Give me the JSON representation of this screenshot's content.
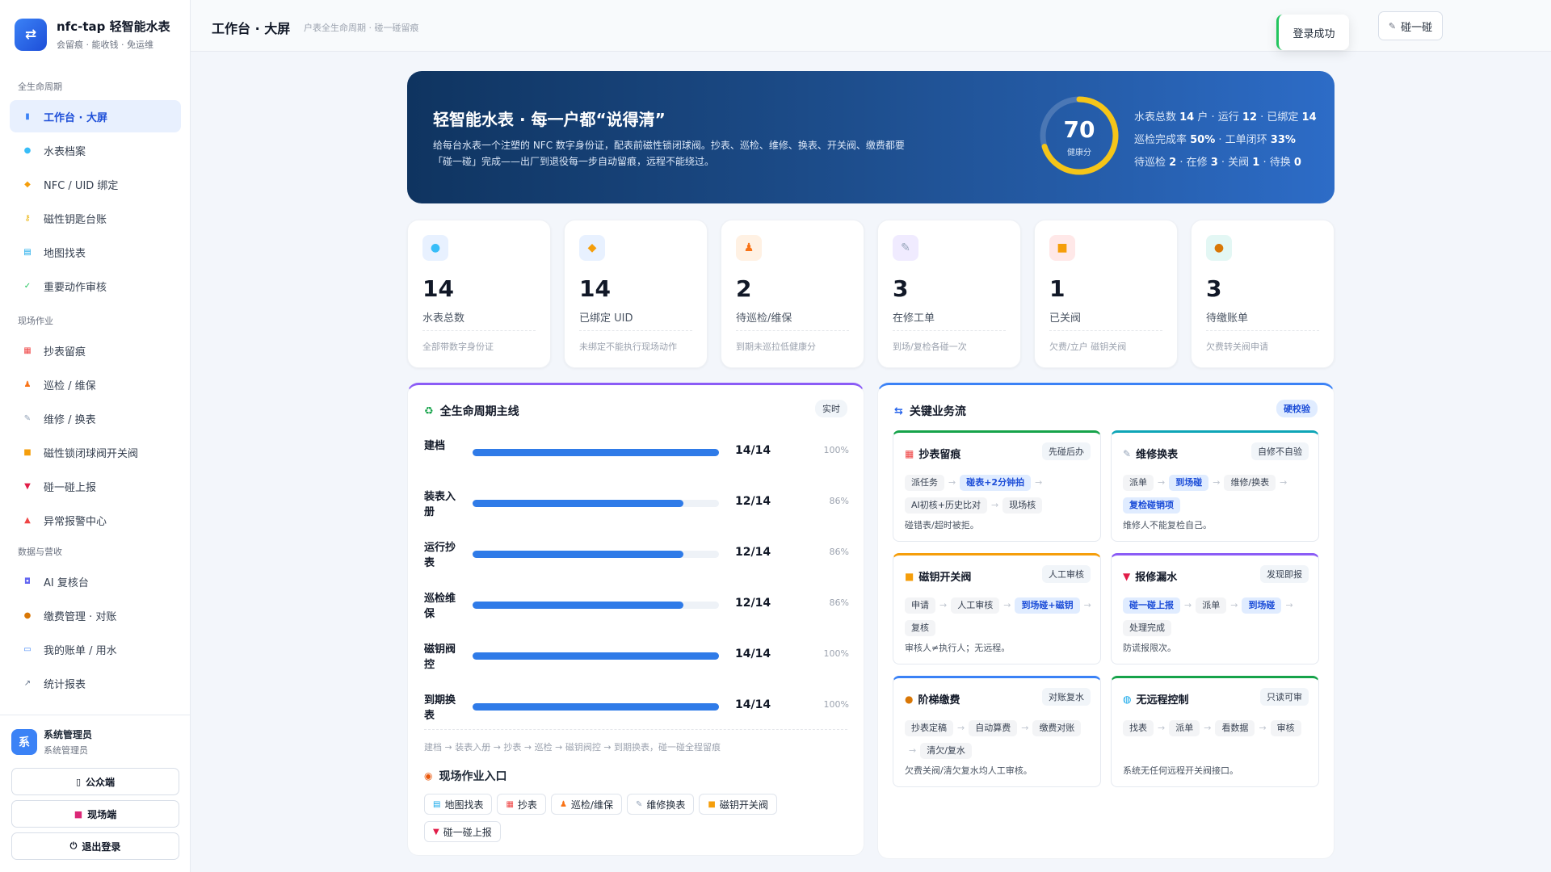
{
  "brand": {
    "title": "nfc-tap 轻智能水表",
    "subtitle": "会留痕 · 能收钱 · 免运维",
    "logo": "shuffle-icon"
  },
  "nav": {
    "groups": [
      {
        "title": "全生命周期",
        "items": [
          {
            "label": "工作台 · 大屏",
            "icon": "chart-icon",
            "active": true
          },
          {
            "label": "水表档案",
            "icon": "drop-icon"
          },
          {
            "label": "NFC / UID 绑定",
            "icon": "tag-icon"
          },
          {
            "label": "磁性钥匙台账",
            "icon": "key-icon"
          },
          {
            "label": "地图找表",
            "icon": "map-icon"
          },
          {
            "label": "重要动作审核",
            "icon": "check-icon"
          }
        ]
      },
      {
        "title": "现场作业",
        "items": [
          {
            "label": "抄表留痕",
            "icon": "abacus-icon"
          },
          {
            "label": "巡检 / 维保",
            "icon": "walker-icon"
          },
          {
            "label": "维修 / 换表",
            "icon": "wrench-icon"
          },
          {
            "label": "磁性锁闭球阀开关阀",
            "icon": "lock-icon"
          },
          {
            "label": "碰一碰上报",
            "icon": "bookmark-icon"
          },
          {
            "label": "异常报警中心",
            "icon": "alarm-icon"
          }
        ]
      },
      {
        "title": "数据与营收",
        "items": [
          {
            "label": "AI 复核台",
            "icon": "robot-icon"
          },
          {
            "label": "缴费管理 · 对账",
            "icon": "moneybag-icon"
          },
          {
            "label": "我的账单 / 用水",
            "icon": "card-icon"
          },
          {
            "label": "统计报表",
            "icon": "trend-icon"
          }
        ]
      }
    ]
  },
  "user": {
    "avatar": "系",
    "name": "系统管理员",
    "role": "系统管理员"
  },
  "footer_buttons": {
    "public": "公众端",
    "field": "现场端",
    "logout": "退出登录"
  },
  "header": {
    "title": "工作台 · 大屏",
    "subtitle": "户表全生命周期 · 碰一碰留痕",
    "tap_button": "碰一碰",
    "toast": "登录成功"
  },
  "hero": {
    "title": "轻智能水表 · 每一户都“说得清”",
    "desc": "给每台水表一个注塑的 NFC 数字身份证，配表前磁性锁闭球阀。抄表、巡检、维修、换表、开关阀、缴费都要「碰一碰」完成——出厂到退役每一步自动留痕，远程不能绕过。",
    "health_score": 70,
    "health_label": "健康分",
    "stats": [
      {
        "p1": "水表总数 ",
        "v1": "14",
        "p2": " 户 · 运行 ",
        "v2": "12",
        "p3": " · 已绑定 ",
        "v3": "14"
      },
      {
        "p1": "巡检完成率 ",
        "v1": "50%",
        "p2": " · 工单闭环 ",
        "v2": "33%",
        "p3": "",
        "v3": ""
      },
      {
        "p1": "待巡检 ",
        "v1": "2",
        "p2": " · 在修 ",
        "v2": "3",
        "p3": " · 关阀 ",
        "v3": "1",
        "p4": " · 待换 ",
        "v4": "0"
      }
    ]
  },
  "kpis": [
    {
      "num": "14",
      "label": "水表总数",
      "note": "全部带数字身份证",
      "icon": "drop-icon",
      "bg": "#e8f1ff"
    },
    {
      "num": "14",
      "label": "已绑定 UID",
      "note": "未绑定不能执行现场动作",
      "icon": "tag-icon",
      "bg": "#e8f1ff"
    },
    {
      "num": "2",
      "label": "待巡检/维保",
      "note": "到期未巡拉低健康分",
      "icon": "walker-icon",
      "bg": "#fff1e3"
    },
    {
      "num": "3",
      "label": "在修工单",
      "note": "到场/复检各碰一次",
      "icon": "wrench-icon",
      "bg": "#f0ebff"
    },
    {
      "num": "1",
      "label": "已关阀",
      "note": "欠费/立户 磁钥关阀",
      "icon": "lock-icon",
      "bg": "#ffe8e8"
    },
    {
      "num": "3",
      "label": "待缴账单",
      "note": "欠费转关阀申请",
      "icon": "moneybag-icon",
      "bg": "#e3f7f4"
    }
  ],
  "lifecycle": {
    "title": "全生命周期主线",
    "tag": "实时",
    "rows": [
      {
        "name": "建档",
        "count": "14/14",
        "pct": "100%",
        "ratio": 1.0
      },
      {
        "name": "装表入册",
        "count": "12/14",
        "pct": "86%",
        "ratio": 0.857
      },
      {
        "name": "运行抄表",
        "count": "12/14",
        "pct": "86%",
        "ratio": 0.857
      },
      {
        "name": "巡检维保",
        "count": "12/14",
        "pct": "86%",
        "ratio": 0.857
      },
      {
        "name": "磁钥阀控",
        "count": "14/14",
        "pct": "100%",
        "ratio": 1.0
      },
      {
        "name": "到期换表",
        "count": "14/14",
        "pct": "100%",
        "ratio": 1.0
      }
    ],
    "flow_note": "建档 → 装表入册 → 抄表 → 巡检 → 磁钥阀控 → 到期换表，碰一碰全程留痕",
    "entry_title": "现场作业入口",
    "entries": [
      {
        "label": "地图找表",
        "icon": "map-icon"
      },
      {
        "label": "抄表",
        "icon": "abacus-icon"
      },
      {
        "label": "巡检/维保",
        "icon": "walker-icon"
      },
      {
        "label": "维修换表",
        "icon": "wrench-icon"
      },
      {
        "label": "磁钥开关阀",
        "icon": "lock-icon"
      },
      {
        "label": "碰一碰上报",
        "icon": "bookmark-icon"
      }
    ]
  },
  "flows": {
    "title": "关键业务流",
    "tag": "硬校验",
    "cards": [
      {
        "title": "抄表留痕",
        "tag": "先碰后办",
        "accent": "#16a34a",
        "icon": "abacus-icon",
        "steps": [
          {
            "t": "派任务"
          },
          {
            "t": "碰表+2分钟拍",
            "hl": true
          },
          {
            "t": "AI初核+历史比对"
          },
          {
            "t": "现场核"
          }
        ],
        "note": "碰错表/超时被拒。"
      },
      {
        "title": "维修换表",
        "tag": "自修不自验",
        "accent": "#0ea5b7",
        "icon": "wrench-icon",
        "steps": [
          {
            "t": "派单"
          },
          {
            "t": "到场碰",
            "hl": true
          },
          {
            "t": "维修/换表"
          },
          {
            "t": "复检碰销项",
            "hl": true
          }
        ],
        "note": "维修人不能复检自己。"
      },
      {
        "title": "磁钥开关阀",
        "tag": "人工审核",
        "accent": "#f59e0b",
        "icon": "lock-icon",
        "steps": [
          {
            "t": "申请"
          },
          {
            "t": "人工审核"
          },
          {
            "t": "到场碰+磁钥",
            "hl": true
          },
          {
            "t": "复核"
          }
        ],
        "note": "审核人≠执行人；无远程。"
      },
      {
        "title": "报修漏水",
        "tag": "发现即报",
        "accent": "#8b5cf6",
        "icon": "bookmark-icon",
        "steps": [
          {
            "t": "碰一碰上报",
            "hl": true
          },
          {
            "t": "派单"
          },
          {
            "t": "到场碰",
            "hl": true
          },
          {
            "t": "处理完成"
          }
        ],
        "note": "防谎报限次。"
      },
      {
        "title": "阶梯缴费",
        "tag": "对账复水",
        "accent": "#3b82f6",
        "icon": "moneybag-icon",
        "steps": [
          {
            "t": "抄表定稿"
          },
          {
            "t": "自动算费"
          },
          {
            "t": "缴费对账"
          },
          {
            "t": "清欠/复水"
          }
        ],
        "note": "欠费关阀/清欠复水均人工审核。"
      },
      {
        "title": "无远程控制",
        "tag": "只读可审",
        "accent": "#16a34a",
        "icon": "globe-icon",
        "steps": [
          {
            "t": "找表"
          },
          {
            "t": "派单"
          },
          {
            "t": "看数据"
          },
          {
            "t": "审核"
          }
        ],
        "note": "系统无任何远程开关阀接口。"
      }
    ]
  },
  "colors": {
    "accent": "#2f7be8",
    "hero_start": "#0f3460",
    "hero_end": "#2d6cc7",
    "gauge": "#f5c518"
  }
}
